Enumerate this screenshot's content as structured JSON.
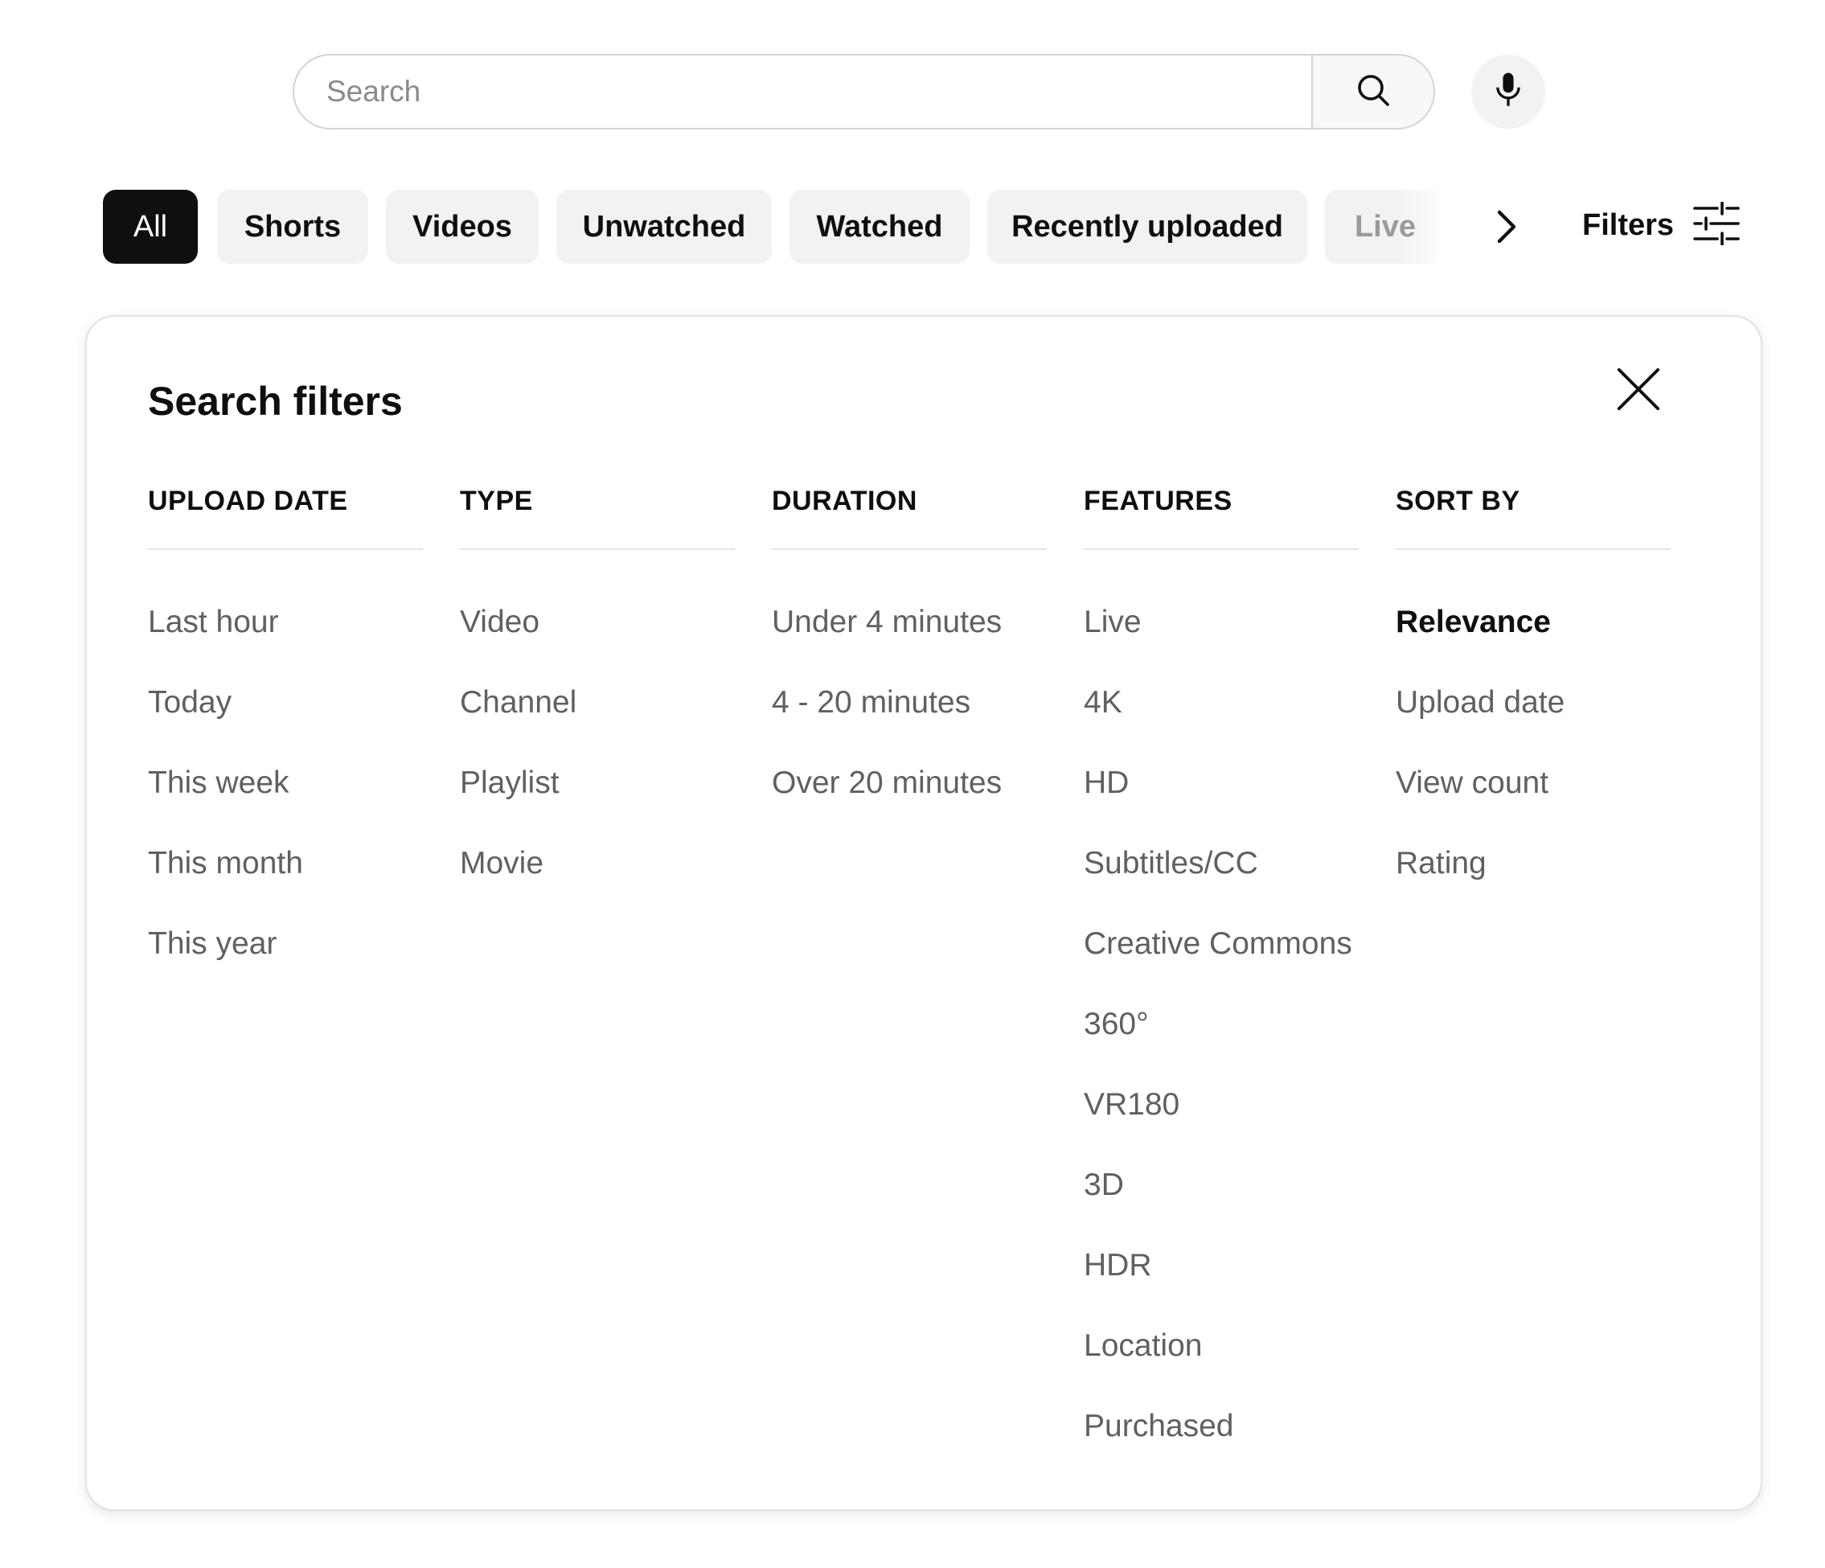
{
  "search": {
    "placeholder": "Search",
    "value": ""
  },
  "icons": {
    "search": "search-icon",
    "mic": "mic-icon",
    "chevron": "chevron-right-icon",
    "filters": "tune-sliders-icon",
    "close": "close-icon"
  },
  "chips": [
    {
      "label": "All",
      "active": true
    },
    {
      "label": "Shorts"
    },
    {
      "label": "Videos"
    },
    {
      "label": "Unwatched"
    },
    {
      "label": "Watched"
    },
    {
      "label": "Recently uploaded"
    },
    {
      "label": "Live"
    }
  ],
  "filters_button": {
    "label": "Filters"
  },
  "panel": {
    "title": "Search filters",
    "columns": [
      {
        "header": "UPLOAD DATE",
        "options": [
          "Last hour",
          "Today",
          "This week",
          "This month",
          "This year"
        ]
      },
      {
        "header": "TYPE",
        "options": [
          "Video",
          "Channel",
          "Playlist",
          "Movie"
        ]
      },
      {
        "header": "DURATION",
        "options": [
          "Under 4 minutes",
          "4 - 20 minutes",
          "Over 20 minutes"
        ]
      },
      {
        "header": "FEATURES",
        "options": [
          "Live",
          "4K",
          "HD",
          "Subtitles/CC",
          "Creative Commons",
          "360°",
          "VR180",
          "3D",
          "HDR",
          "Location",
          "Purchased"
        ]
      },
      {
        "header": "SORT BY",
        "options": [
          "Relevance",
          "Upload date",
          "View count",
          "Rating"
        ],
        "selected": "Relevance"
      }
    ]
  },
  "colors": {
    "text_primary": "#0f0f0f",
    "text_secondary": "#606060",
    "chip_bg": "#f2f2f2",
    "chip_active_bg": "#0f0f0f"
  }
}
